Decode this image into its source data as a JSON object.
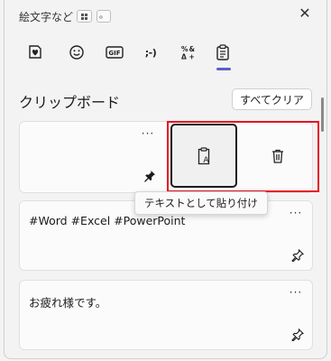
{
  "header": {
    "title": "絵文字など",
    "shortcut_key_dot": "。",
    "close_glyph": "✕"
  },
  "tabs": [
    {
      "name": "recent-emoji-tab",
      "label": "♥"
    },
    {
      "name": "emoji-tab",
      "label": "☺"
    },
    {
      "name": "gif-tab",
      "label": "GIF"
    },
    {
      "name": "kaomoji-tab",
      "label": ";-)"
    },
    {
      "name": "symbols-tab",
      "label": "%&"
    },
    {
      "name": "clipboard-tab",
      "label": "",
      "active": true
    }
  ],
  "clipboard": {
    "title": "クリップボード",
    "clear_all_label": "すべてクリア",
    "more_glyph": "···",
    "paste_as_text_tooltip": "テキストとして貼り付け",
    "items": [
      {
        "text": ""
      },
      {
        "text": "#Word #Excel #PowerPoint"
      },
      {
        "text": "お疲れ様です。"
      }
    ]
  },
  "colors": {
    "accent": "#5b5fc7",
    "highlight_frame": "#e81123"
  },
  "icons": {
    "paste_text": "clipboard-text-icon",
    "delete": "trash-icon",
    "pin": "pin-icon",
    "pin_filled": "pin-filled-icon"
  }
}
